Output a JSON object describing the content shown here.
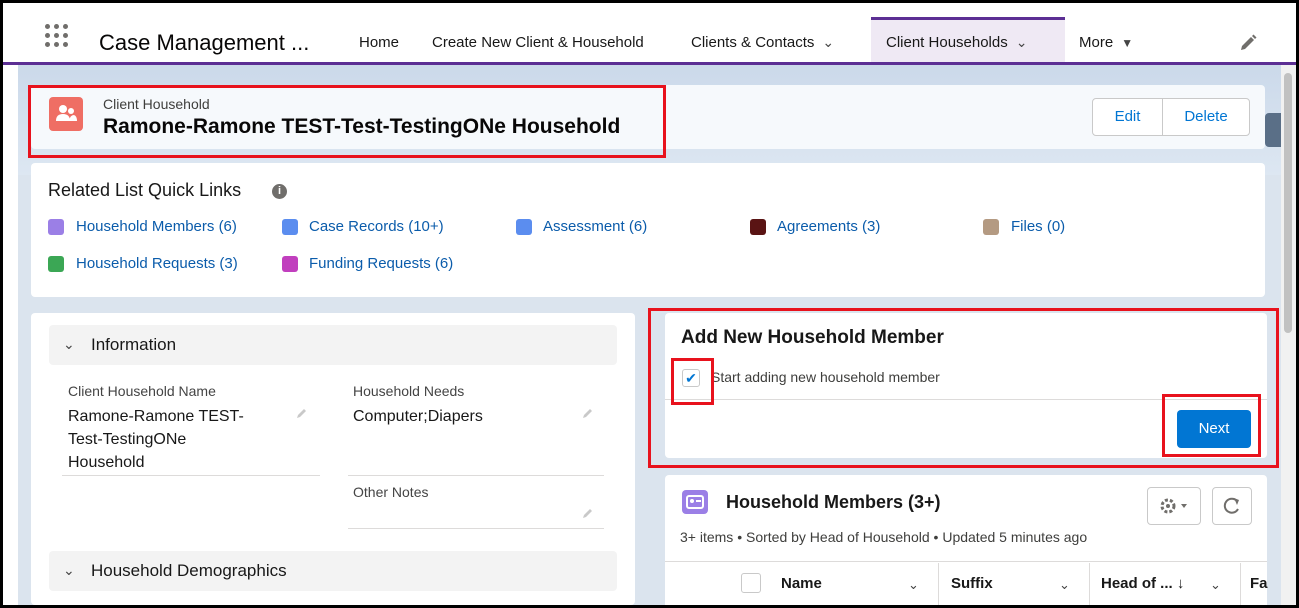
{
  "app": {
    "name": "Case Management ..."
  },
  "nav": {
    "items": [
      {
        "label": "Home"
      },
      {
        "label": "Create New Client & Household"
      },
      {
        "label": "Clients & Contacts"
      },
      {
        "label": "Client Households"
      },
      {
        "label": "More"
      }
    ],
    "active": "Client Households"
  },
  "record": {
    "object_label": "Client Household",
    "title": "Ramone-Ramone TEST-Test-TestingONe Household",
    "actions": {
      "edit": "Edit",
      "delete": "Delete"
    }
  },
  "quick_links": {
    "title": "Related List Quick Links",
    "info_icon": "i",
    "links": [
      {
        "label": "Household Members (6)",
        "icon": "contact-card-icon",
        "color": "#9b7fe6"
      },
      {
        "label": "Case Records (10+)",
        "icon": "case-icon",
        "color": "#5b8def"
      },
      {
        "label": "Assessment (6)",
        "icon": "assessment-icon",
        "color": "#5b8def"
      },
      {
        "label": "Agreements (3)",
        "icon": "agreement-icon",
        "color": "#5a1414"
      },
      {
        "label": "Files (0)",
        "icon": "files-icon",
        "color": "#b49a82"
      },
      {
        "label": "Household Requests (3)",
        "icon": "request-icon",
        "color": "#3ba755"
      },
      {
        "label": "Funding Requests (6)",
        "icon": "funding-icon",
        "color": "#c13fbe"
      }
    ]
  },
  "information": {
    "section_title": "Information",
    "fields": {
      "household_name": {
        "label": "Client Household Name",
        "value_lines": [
          "Ramone-Ramone TEST-",
          "Test-TestingONe",
          "Household"
        ]
      },
      "household_needs": {
        "label": "Household Needs",
        "value": "Computer;Diapers"
      },
      "other_notes": {
        "label": "Other Notes",
        "value": ""
      }
    },
    "demographics_title": "Household Demographics"
  },
  "add_member": {
    "title": "Add New Household Member",
    "checkbox_label": "Start adding new household member",
    "checked": true,
    "next_label": "Next"
  },
  "members_list": {
    "title": "Household Members (3+)",
    "meta": "3+ items • Sorted by Head of Household • Updated 5 minutes ago",
    "columns": [
      "Name",
      "Suffix",
      "Head of ... ↓",
      "Fa"
    ]
  },
  "colors": {
    "brand_purple": "#5c2f94",
    "link_blue": "#0b5cab",
    "button_blue": "#0176d3",
    "highlight_red": "#e8121d",
    "record_icon": "#ef6e64"
  }
}
